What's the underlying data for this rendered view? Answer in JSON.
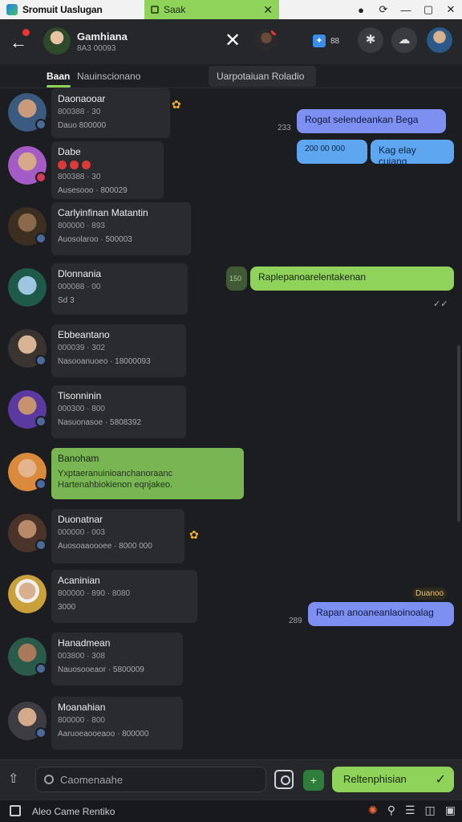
{
  "titlebar": {
    "app_name": "Sromuit Uaslugan",
    "tab_label": "Saak",
    "tab_close": "✕",
    "controls": [
      "●",
      "⟳",
      "—",
      "▢",
      "✕"
    ]
  },
  "header": {
    "back": "←",
    "contact_name": "Gamhiana",
    "contact_sub": "8A3 00093",
    "close": "✕",
    "share_label": "88",
    "share_icon": "✦",
    "puzzle_icon": "✱",
    "cloud_icon": "☁"
  },
  "tabs": {
    "active": "Baan",
    "second": "Nauinscionano",
    "right": "Uarpotaiuan Roladio"
  },
  "rows": [
    {
      "name": "Daonaooar",
      "sub": "800388 · 30",
      "meta": "Dauo 800000",
      "emoji": "✿"
    },
    {
      "name": "Dabe",
      "sub": "800388 · 30",
      "meta": "Ausesooo · 800029",
      "emoji": ""
    },
    {
      "name": "Carlyinfinan Matantin",
      "sub": "800000 · 893",
      "meta": "Auosolaroo · 500003",
      "emoji": ""
    },
    {
      "name": "Dlonnania",
      "sub": "000088 · 00",
      "meta": "Sd 3",
      "emoji": ""
    },
    {
      "name": "Ebbeantano",
      "sub": "000039 · 302",
      "meta": "Nasooanuoeo · 18000093",
      "emoji": ""
    },
    {
      "name": "Tisonninin",
      "sub": "000300 · 800",
      "meta": "Nasuonasoe · 5808392",
      "emoji": ""
    },
    {
      "name": "Banoham",
      "sub": "Yxptaeranuinioanchanoraanc",
      "meta": "Hartenahbiokienon eqnjakeo.",
      "emoji": ""
    },
    {
      "name": "Duonatnar",
      "sub": "000000 · 003",
      "meta": "Auosoaaoooee · 8000 000",
      "emoji": "✿"
    },
    {
      "name": "Acaninian",
      "sub": "800000 · 890 · 8080",
      "meta": "3000",
      "emoji": ""
    },
    {
      "name": "Hanadmean",
      "sub": "003800 · 308",
      "meta": "Nauosooeaor · 5800009",
      "emoji": ""
    },
    {
      "name": "Moanahian",
      "sub": "800000 · 800",
      "meta": "Aaruoeaooeaoo · 800000",
      "emoji": ""
    }
  ],
  "messages": [
    {
      "text": "Rogat selendeankan Bega",
      "time": "233"
    },
    {
      "text": "200 00 000",
      "time": ""
    },
    {
      "text": "Kag elay cuiang",
      "time": ""
    },
    {
      "text": "Raplepanoarelentakenan",
      "time": "150"
    },
    {
      "text": "Rapan anoaneanlaoinoalag",
      "time": "289",
      "tag": "Duanoo"
    }
  ],
  "composer": {
    "attach": "⇧",
    "placeholder": "Caomenaahe",
    "plus": "+",
    "send_label": "Reltenphisian",
    "send_icon": "✓"
  },
  "footer": {
    "label": "Aleo Came Rentiko",
    "tools": [
      "✺",
      "⚲",
      "☰",
      "◫",
      "▣"
    ]
  },
  "colors": {
    "accent_green": "#8fd35a",
    "bubble_blue": "#7d8ff0",
    "bg": "#1c1d20"
  }
}
